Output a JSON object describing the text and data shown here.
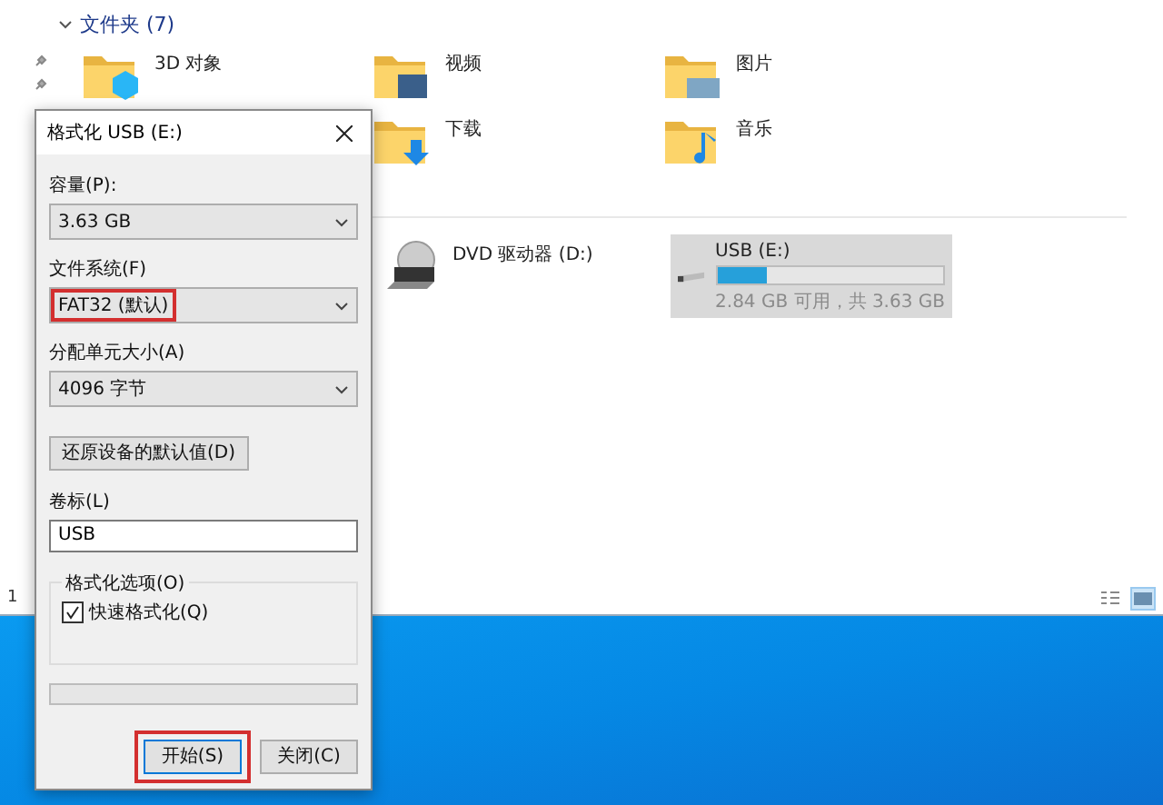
{
  "explorer": {
    "section_header": "文件夹 (7)",
    "folders": [
      {
        "name": "3D 对象",
        "kind": "objects"
      },
      {
        "name": "视频",
        "kind": "video"
      },
      {
        "name": "图片",
        "kind": "pictures"
      },
      {
        "name": "下载",
        "kind": "downloads"
      },
      {
        "name": "音乐",
        "kind": "music"
      }
    ],
    "drives": [
      {
        "name": "DVD 驱动器 (D:)",
        "kind": "dvd",
        "selected": false
      },
      {
        "name": "USB (E:)",
        "kind": "usb",
        "selected": true,
        "level": 0.22,
        "space": "2.84 GB 可用，共 3.63 GB"
      }
    ],
    "status_text": "1",
    "views": [
      {
        "kind": "details",
        "selected": false
      },
      {
        "kind": "tiles",
        "selected": true
      }
    ]
  },
  "dialog": {
    "title": "格式化 USB (E:)",
    "fields": [
      {
        "label": "容量(P):",
        "value": "3.63 GB",
        "highlighted": false
      },
      {
        "label": "文件系统(F)",
        "value": "FAT32 (默认)",
        "highlighted": true
      },
      {
        "label": "分配单元大小(A)",
        "value": "4096 字节",
        "highlighted": false
      }
    ],
    "restore_button": "还原设备的默认值(D)",
    "volume_label": {
      "label": "卷标(L)",
      "value": "USB"
    },
    "options_group": {
      "title": "格式化选项(O)",
      "checkbox": {
        "label": "快速格式化(Q)",
        "checked": true
      }
    },
    "progress": {
      "level": 0
    },
    "buttons": [
      {
        "label": "开始(S)",
        "default": true,
        "highlighted": true
      },
      {
        "label": "关闭(C)",
        "default": false,
        "highlighted": false
      }
    ]
  }
}
